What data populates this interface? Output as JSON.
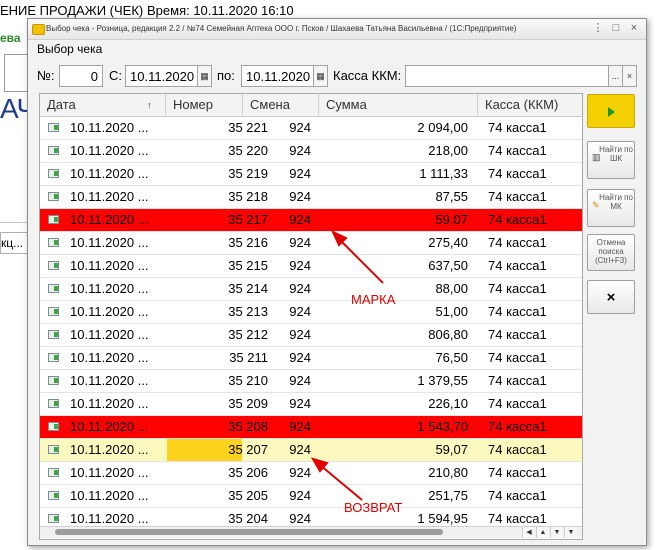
{
  "background": {
    "header_left": "ЕНИЕ ПРОДАЖИ (ЧЕК)",
    "header_time": "Время: 10.11.2020 16:10",
    "green_fragment": "ева",
    "big_fragment": "АЧ",
    "small_fragment": "кц..."
  },
  "window": {
    "title": "Выбор чека - Розница, редакция 2.2 / №74 Семейная Аптека ООО г. Псков / Шахаева Татьяна Васильевна / (1С:Предприятие)",
    "controls": [
      "⋮",
      "□",
      "×"
    ]
  },
  "form": {
    "title": "Выбор чека",
    "number_label": "№:",
    "number_value": "0",
    "from_label": "С:",
    "from_value": "10.11.2020",
    "to_label": "по:",
    "to_value": "10.11.2020",
    "register_label": "Касса ККМ:",
    "register_value": "",
    "register_select": "...",
    "register_clear": "×"
  },
  "table": {
    "columns": [
      "Дата",
      "Номер",
      "Смена",
      "Сумма",
      "Касса (ККМ)"
    ],
    "sort_indicator": "↑",
    "rows": [
      {
        "date": "10.11.2020 ...",
        "number": "35 221",
        "shift": "924",
        "sum": "2 094,00",
        "register": "74 касса1",
        "style": "normal"
      },
      {
        "date": "10.11.2020 ...",
        "number": "35 220",
        "shift": "924",
        "sum": "218,00",
        "register": "74 касса1",
        "style": "normal"
      },
      {
        "date": "10.11.2020 ...",
        "number": "35 219",
        "shift": "924",
        "sum": "1 111,33",
        "register": "74 касса1",
        "style": "normal"
      },
      {
        "date": "10.11.2020 ...",
        "number": "35 218",
        "shift": "924",
        "sum": "87,55",
        "register": "74 касса1",
        "style": "normal"
      },
      {
        "date": "10.11.2020 ...",
        "number": "35 217",
        "shift": "924",
        "sum": "59,07",
        "register": "74 касса1",
        "style": "red"
      },
      {
        "date": "10.11.2020 ...",
        "number": "35 216",
        "shift": "924",
        "sum": "275,40",
        "register": "74 касса1",
        "style": "normal"
      },
      {
        "date": "10.11.2020 ...",
        "number": "35 215",
        "shift": "924",
        "sum": "637,50",
        "register": "74 касса1",
        "style": "normal"
      },
      {
        "date": "10.11.2020 ...",
        "number": "35 214",
        "shift": "924",
        "sum": "88,00",
        "register": "74 касса1",
        "style": "normal"
      },
      {
        "date": "10.11.2020 ...",
        "number": "35 213",
        "shift": "924",
        "sum": "51,00",
        "register": "74 касса1",
        "style": "normal"
      },
      {
        "date": "10.11.2020 ...",
        "number": "35 212",
        "shift": "924",
        "sum": "806,80",
        "register": "74 касса1",
        "style": "normal"
      },
      {
        "date": "10.11.2020 ...",
        "number": "35 211",
        "shift": "924",
        "sum": "76,50",
        "register": "74 касса1",
        "style": "normal"
      },
      {
        "date": "10.11.2020 ...",
        "number": "35 210",
        "shift": "924",
        "sum": "1 379,55",
        "register": "74 касса1",
        "style": "normal"
      },
      {
        "date": "10.11.2020 ...",
        "number": "35 209",
        "shift": "924",
        "sum": "226,10",
        "register": "74 касса1",
        "style": "normal"
      },
      {
        "date": "10.11.2020 ...",
        "number": "35 208",
        "shift": "924",
        "sum": "1 543,70",
        "register": "74 касса1",
        "style": "red"
      },
      {
        "date": "10.11.2020 ...",
        "number": "35 207",
        "shift": "924",
        "sum": "59,07",
        "register": "74 касса1",
        "style": "selected"
      },
      {
        "date": "10.11.2020 ...",
        "number": "35 206",
        "shift": "924",
        "sum": "210,80",
        "register": "74 касса1",
        "style": "normal"
      },
      {
        "date": "10.11.2020 ...",
        "number": "35 205",
        "shift": "924",
        "sum": "251,75",
        "register": "74 касса1",
        "style": "normal"
      },
      {
        "date": "10.11.2020 ...",
        "number": "35 204",
        "shift": "924",
        "sum": "1 594,95",
        "register": "74 касса1",
        "style": "normal"
      }
    ],
    "scroll_buttons": [
      "◀",
      "▲",
      "▼",
      "▼"
    ]
  },
  "buttons": {
    "select_icon": "play-icon",
    "find_shk": "Найти по ШК",
    "find_mk": "Найти по МК",
    "cancel_search": "Отмена поиска (Ctrl+F3)",
    "close": "×"
  },
  "annotations": {
    "marka": "МАРКА",
    "vozvrat": "ВОЗВРАТ",
    "color": "#e00000"
  },
  "colors": {
    "red_row": "#ff0000",
    "selected_row": "#fbf9be",
    "selected_cell": "#ffd21e",
    "select_button": "#f5d000"
  }
}
